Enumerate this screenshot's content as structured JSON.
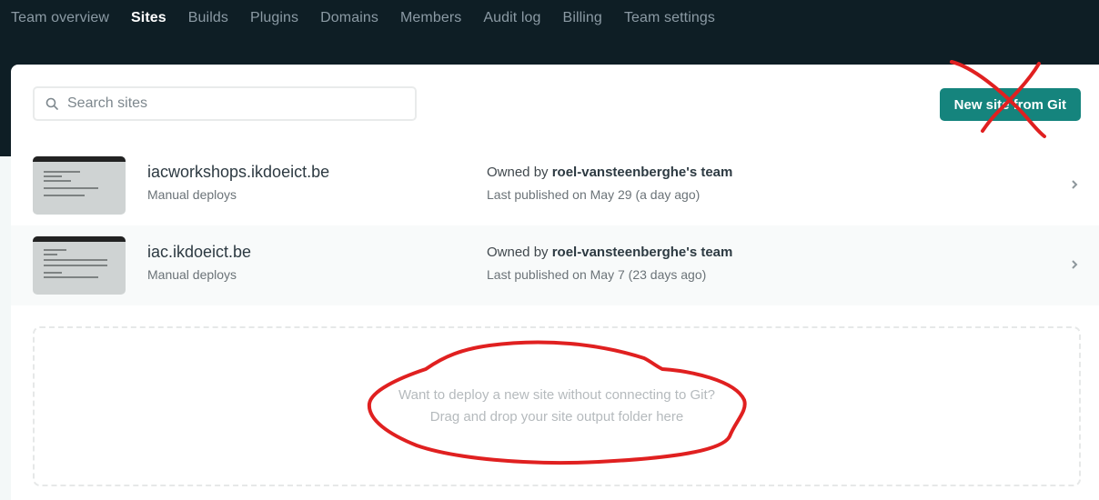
{
  "nav": {
    "items": [
      {
        "label": "Team overview",
        "active": false
      },
      {
        "label": "Sites",
        "active": true
      },
      {
        "label": "Builds",
        "active": false
      },
      {
        "label": "Plugins",
        "active": false
      },
      {
        "label": "Domains",
        "active": false
      },
      {
        "label": "Members",
        "active": false
      },
      {
        "label": "Audit log",
        "active": false
      },
      {
        "label": "Billing",
        "active": false
      },
      {
        "label": "Team settings",
        "active": false
      }
    ]
  },
  "search": {
    "placeholder": "Search sites",
    "value": ""
  },
  "toolbar": {
    "new_site_label": "New site from Git"
  },
  "sites": [
    {
      "name": "iacworkshops.ikdoeict.be",
      "deploy_type": "Manual deploys",
      "owner_prefix": "Owned by",
      "owner": "roel-vansteenberghe's team",
      "published": "Last published on May 29 (a day ago)"
    },
    {
      "name": "iac.ikdoeict.be",
      "deploy_type": "Manual deploys",
      "owner_prefix": "Owned by",
      "owner": "roel-vansteenberghe's team",
      "published": "Last published on May 7 (23 days ago)"
    }
  ],
  "dropzone": {
    "line1": "Want to deploy a new site without connecting to Git?",
    "line2": "Drag and drop your site output folder here"
  },
  "colors": {
    "nav_bg": "#0e1e25",
    "accent": "#15847d",
    "annotation": "#e02020"
  }
}
